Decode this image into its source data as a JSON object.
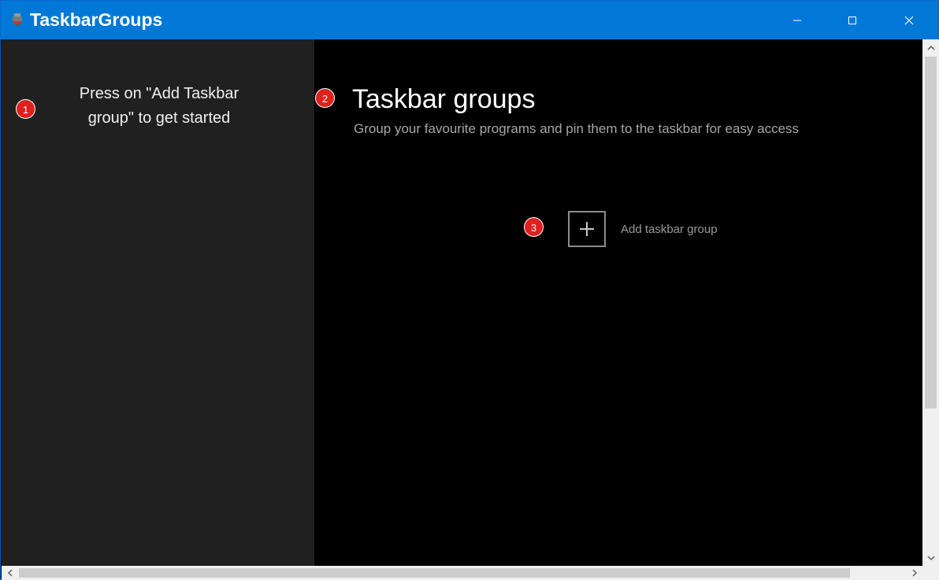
{
  "window": {
    "title": "TaskbarGroups",
    "icon": "app-icon",
    "accent_color": "#0078d7"
  },
  "sidebar": {
    "hint": "Press on \"Add Taskbar group\" to get started"
  },
  "main": {
    "title": "Taskbar groups",
    "subtitle": "Group your favourite programs and pin them to the taskbar for easy access",
    "add_button_label": "Add taskbar group"
  },
  "annotations": [
    "1",
    "2",
    "3"
  ],
  "colors": {
    "sidebar_bg": "#202020",
    "main_bg": "#000000",
    "badge": "#e0201e"
  }
}
